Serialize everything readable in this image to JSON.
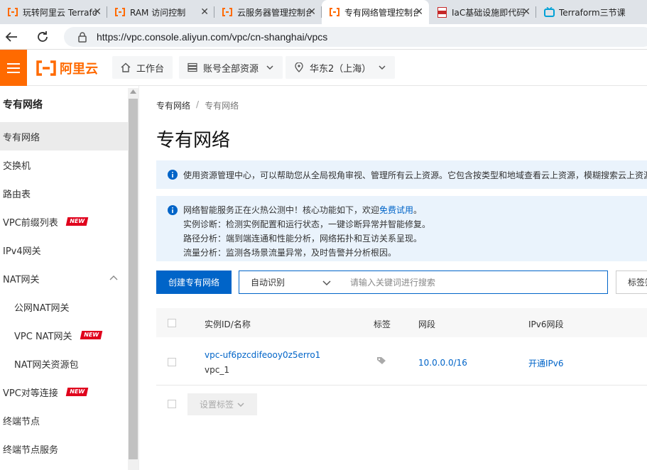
{
  "browser": {
    "tabs": [
      {
        "title": "玩转阿里云 Terraform",
        "icon": "aliyun-icon",
        "active": false
      },
      {
        "title": "RAM 访问控制",
        "icon": "aliyun-icon",
        "active": false
      },
      {
        "title": "云服务器管理控制台",
        "icon": "aliyun-icon",
        "active": false
      },
      {
        "title": "专有网络管理控制台",
        "icon": "aliyun-icon",
        "active": true
      },
      {
        "title": "IaC基础设施即代码",
        "icon": "pdf-icon",
        "active": false
      },
      {
        "title": "Terraform三节课",
        "icon": "tv-icon",
        "active": false
      }
    ],
    "url": "https://vpc.console.aliyun.com/vpc/cn-shanghai/vpcs"
  },
  "header": {
    "logo_text": "阿里云",
    "workbench": "工作台",
    "account": "账号全部资源",
    "region": "华东2（上海）"
  },
  "sidebar": {
    "title": "专有网络",
    "items": [
      {
        "label": "专有网络",
        "active": true
      },
      {
        "label": "交换机"
      },
      {
        "label": "路由表"
      },
      {
        "label": "VPC前缀列表",
        "badge": "NEW"
      },
      {
        "label": "IPv4网关"
      },
      {
        "label": "NAT网关"
      },
      {
        "label": "公网NAT网关"
      },
      {
        "label": "VPC NAT网关",
        "badge": "NEW"
      },
      {
        "label": "NAT网关资源包"
      },
      {
        "label": "VPC对等连接",
        "badge": "NEW"
      },
      {
        "label": "终端节点"
      },
      {
        "label": "终端节点服务"
      }
    ]
  },
  "main": {
    "breadcrumb": [
      "专有网络",
      "专有网络"
    ],
    "breadcrumb_sep": "/",
    "title": "专有网络",
    "notice1": "使用资源管理中心，可以帮助您从全局视角审视、管理所有云上资源。它包含按类型和地域查看云上资源，模糊搜索云上资源",
    "notice2": {
      "line1_prefix": "网络智能服务正在火热公测中！核心功能如下，欢迎",
      "line1_link": "免费试用",
      "line1_suffix": "。",
      "line2": "实例诊断：检测实例配置和运行状态，一键诊断异常并智能修复。",
      "line3": "路径分析：端到端连通和性能分析，网络拓扑和互访关系呈现。",
      "line4": "流量分析：监测各场景流量异常，及时告警并分析根因。"
    },
    "create_button": "创建专有网络",
    "search_select": "自动识别",
    "search_placeholder": "请输入关键词进行搜索",
    "tag_filter": "标签筛选",
    "table": {
      "headers": [
        "实例ID/名称",
        "标签",
        "网段",
        "IPv6网段"
      ],
      "rows": [
        {
          "id": "vpc-uf6pzcdifeooy0z5erro1",
          "name": "vpc_1",
          "cidr": "10.0.0.0/16",
          "ipv6": "开通IPv6"
        }
      ]
    },
    "set_tag_button": "设置标签"
  },
  "colors": {
    "brand": "#ff6a00",
    "primary": "#0064c8",
    "notice_bg": "#eaf3fc",
    "badge_red": "#e0001c"
  }
}
